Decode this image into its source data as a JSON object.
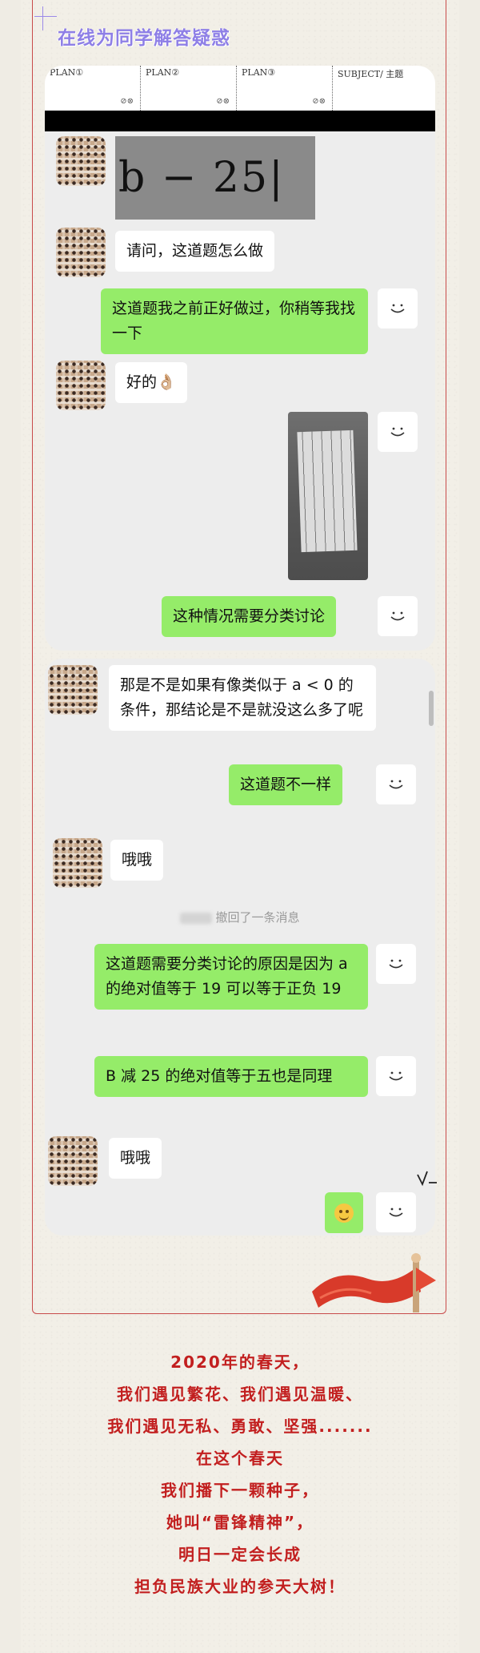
{
  "header": {
    "title": "在线为同学解答疑惑"
  },
  "plan_table": {
    "cells": [
      "PLAN①",
      "PLAN②",
      "PLAN③",
      "SUBJECT/ 主题"
    ],
    "marks": "⊘⊗"
  },
  "chat1": {
    "equation_image_text": "b − 25| =",
    "messages": [
      {
        "side": "left",
        "type": "text",
        "text": "请问，这道题怎么做"
      },
      {
        "side": "right",
        "type": "text",
        "text": "这道题我之前正好做过，你稍等我找一下"
      },
      {
        "side": "left",
        "type": "text",
        "text": "好的👌🏼"
      },
      {
        "side": "right",
        "type": "image"
      },
      {
        "side": "right",
        "type": "text",
        "text": "这种情况需要分类讨论"
      }
    ]
  },
  "chat2": {
    "messages": [
      {
        "side": "left",
        "type": "text",
        "text": "那是不是如果有像类似于 a < 0 的条件，那结论是不是就没这么多了呢"
      },
      {
        "side": "right",
        "type": "text",
        "text": "这道题不一样"
      },
      {
        "side": "left",
        "type": "text",
        "text": "哦哦"
      },
      {
        "type": "system",
        "text": "撤回了一条消息"
      },
      {
        "side": "right",
        "type": "text",
        "text": "这道题需要分类讨论的原因是因为 a 的绝对值等于 19 可以等于正负 19"
      },
      {
        "side": "right",
        "type": "text",
        "text": "B 减 25 的绝对值等于五也是同理"
      },
      {
        "side": "left",
        "type": "text",
        "text": "哦哦"
      },
      {
        "side": "right",
        "type": "emoji"
      }
    ]
  },
  "poem": {
    "lines": [
      "2020年的春天，",
      "我们遇见繁花、我们遇见温暖、",
      "我们遇见无私、勇敢、坚强.......",
      "在这个春天",
      "我们播下一颗种子，",
      "她叫“雷锋精神”，",
      "明日一定会长成",
      "担负民族大业的参天大树！"
    ]
  },
  "colors": {
    "title": "#8e7fe6",
    "green_bubble": "#95ec69",
    "poem": "#c21f1f",
    "frame": "#c84b4b"
  },
  "icons": [
    "smile-icon",
    "ok-hand-emoji",
    "smiley-emoji",
    "red-flag",
    "signature"
  ]
}
